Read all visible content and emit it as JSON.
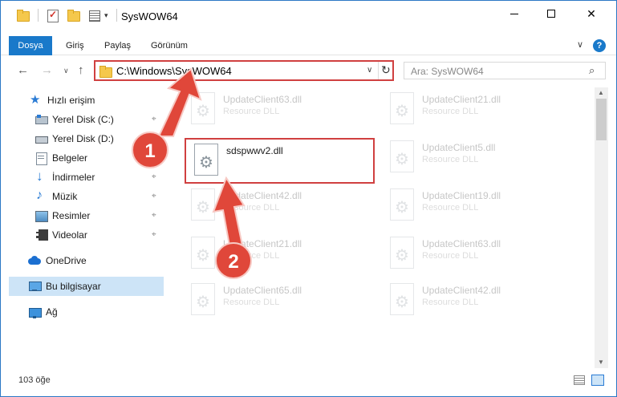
{
  "window": {
    "title": "SysWOW64",
    "qat_arrow": "▾",
    "close_glyph": "✕"
  },
  "ribbon": {
    "tabs": [
      "Dosya",
      "Giriş",
      "Paylaş",
      "Görünüm"
    ],
    "chevron": "∨",
    "help": "?"
  },
  "nav": {
    "back": "←",
    "forward": "→",
    "recent": "∨",
    "up": "↑",
    "address": "C:\\Windows\\SysWOW64",
    "address_dropdown": "∨",
    "refresh": "↻",
    "search_placeholder": "Ara: SysWOW64",
    "search_glyph": "⌕"
  },
  "sidebar": {
    "items": [
      {
        "label": "Hızlı erişim",
        "icon": "star-icon",
        "pinned": false
      },
      {
        "label": "Yerel Disk (C:)",
        "icon": "drive-icon",
        "pinned": true
      },
      {
        "label": "Yerel Disk (D:)",
        "icon": "drive-icon",
        "pinned": true
      },
      {
        "label": "Belgeler",
        "icon": "documents-icon",
        "pinned": true
      },
      {
        "label": "İndirmeler",
        "icon": "downloads-icon",
        "pinned": true
      },
      {
        "label": "Müzik",
        "icon": "music-icon",
        "pinned": true
      },
      {
        "label": "Resimler",
        "icon": "pictures-icon",
        "pinned": true
      },
      {
        "label": "Videolar",
        "icon": "videos-icon",
        "pinned": true
      },
      {
        "label": "OneDrive",
        "icon": "onedrive-icon",
        "pinned": false
      },
      {
        "label": "Bu bilgisayar",
        "icon": "computer-icon",
        "pinned": false,
        "selected": true
      },
      {
        "label": "Ağ",
        "icon": "network-icon",
        "pinned": false
      }
    ],
    "pin_glyph": "⌖"
  },
  "files": [
    {
      "name": "UpdateClient63.dll",
      "type": "Resource DLL",
      "faded": true
    },
    {
      "name": "UpdateClient21.dll",
      "type": "Resource DLL",
      "faded": true
    },
    {
      "name": "sdspwwv2.dll",
      "type": "",
      "faded": false,
      "highlighted": true
    },
    {
      "name": "UpdateClient5.dll",
      "type": "Resource DLL",
      "faded": true
    },
    {
      "name": "UpdateClient42.dll",
      "type": "Resource DLL",
      "faded": true
    },
    {
      "name": "UpdateClient19.dll",
      "type": "Resource DLL",
      "faded": true
    },
    {
      "name": "UpdateClient21.dll",
      "type": "Resource DLL",
      "faded": true
    },
    {
      "name": "UpdateClient63.dll",
      "type": "Resource DLL",
      "faded": true
    },
    {
      "name": "UpdateClient65.dll",
      "type": "Resource DLL",
      "faded": true
    },
    {
      "name": "UpdateClient42.dll",
      "type": "Resource DLL",
      "faded": true
    }
  ],
  "status": {
    "count": "103 öğe"
  },
  "annotations": {
    "badge_1": "1",
    "badge_2": "2",
    "color": "#e0473a"
  },
  "colors": {
    "accent": "#1979ca",
    "highlight": "#d04040",
    "selected_bg": "#cde4f7"
  }
}
